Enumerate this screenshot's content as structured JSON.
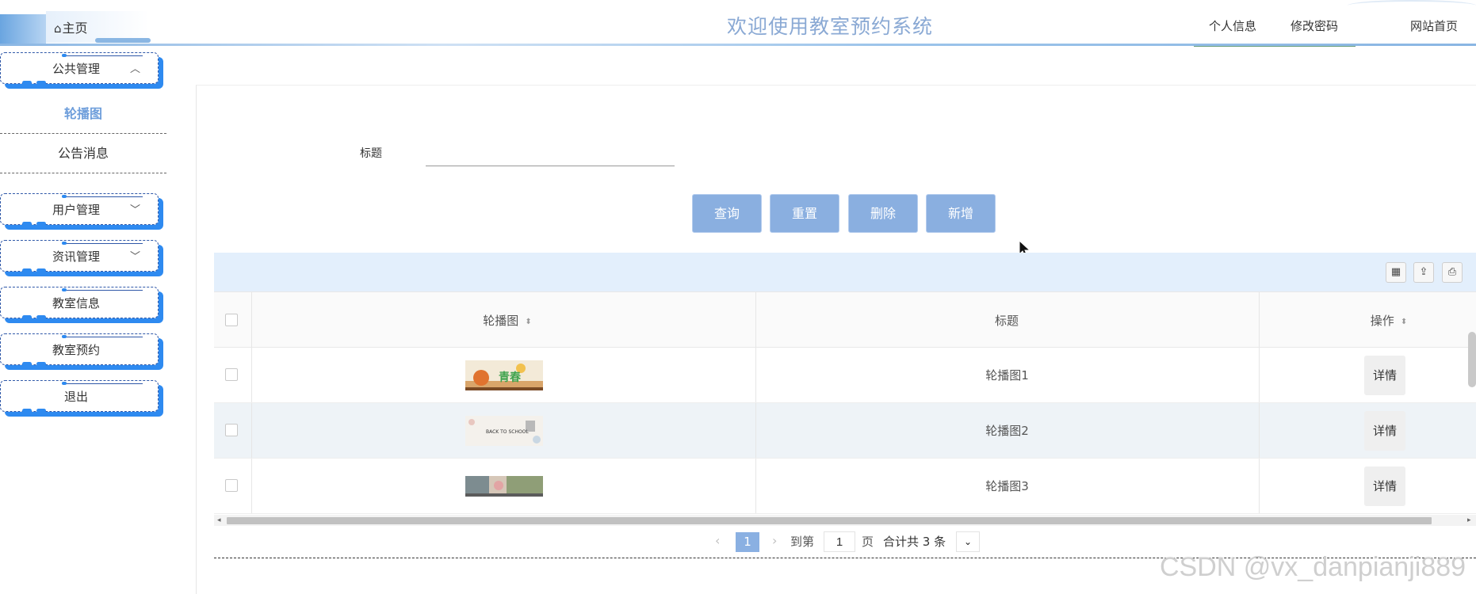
{
  "header": {
    "home_label": "主页",
    "site_title": "欢迎使用教室预约系统",
    "nav": [
      "个人信息",
      "修改密码",
      "网站首页"
    ]
  },
  "sidebar": {
    "groups": [
      {
        "label": "公共管理",
        "expanded": true,
        "items": [
          "轮播图",
          "公告消息"
        ],
        "active_item": "轮播图"
      },
      {
        "label": "用户管理",
        "expanded": false
      },
      {
        "label": "资讯管理",
        "expanded": false
      },
      {
        "label": "教室信息"
      },
      {
        "label": "教室预约"
      },
      {
        "label": "退出"
      }
    ]
  },
  "search": {
    "title_label": "标题",
    "title_value": "",
    "buttons": [
      "查询",
      "重置",
      "删除",
      "新增"
    ]
  },
  "table": {
    "columns": [
      "轮播图",
      "标题",
      "操作"
    ],
    "rows": [
      {
        "image": "carousel-thumb-1",
        "title": "轮播图1",
        "action": "详情"
      },
      {
        "image": "carousel-thumb-2",
        "title": "轮播图2",
        "action": "详情"
      },
      {
        "image": "carousel-thumb-3",
        "title": "轮播图3",
        "action": "详情"
      }
    ]
  },
  "pagination": {
    "current_page": "1",
    "goto_prefix": "到第",
    "goto_value": "1",
    "goto_suffix": "页",
    "total_text": "合计共 3 条"
  },
  "thumb_texts": {
    "t1": "青春",
    "t2": "BACK TO SCHOOL"
  },
  "watermark": "CSDN @vx_danpianji889",
  "colors": {
    "accent": "#8ab0e2",
    "title": "#8aa9d4",
    "toolbar_bg": "#e3effc",
    "menu_shadow": "#2e8af0",
    "nav_underline": "#6a9e7c"
  }
}
